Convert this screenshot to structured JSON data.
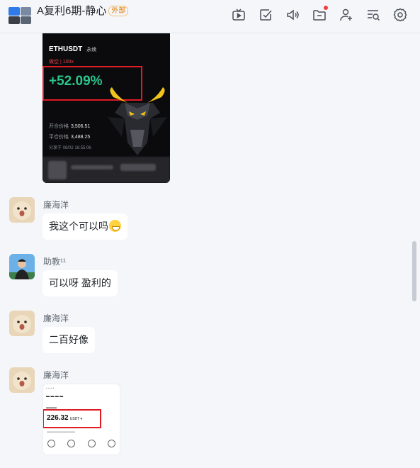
{
  "header": {
    "title": "A复利6期-静心",
    "tag": "外部",
    "subtitle": "",
    "tools": [
      "live-icon",
      "task-icon",
      "announcement-icon",
      "folder-icon",
      "add-member-icon",
      "search-history-icon",
      "settings-icon"
    ]
  },
  "share_card": {
    "symbol": "ETHUSDT",
    "perp": "永续",
    "direction": "做空 | 100x",
    "pnl": "+52.09%",
    "open_label": "开仓价格",
    "open_price": "3,506.51",
    "close_label": "平仓价格",
    "close_price": "3,488.25",
    "shared_at": "分享于 08/02 16:55:06"
  },
  "messages": [
    {
      "sender": "廉海洋",
      "text": "我这个可以吗",
      "emoji": "grinning-sweat-emoji"
    },
    {
      "sender": "助教¹¹",
      "text": "可以呀 盈利的"
    },
    {
      "sender": "廉海洋",
      "text": "二百好像"
    },
    {
      "sender": "廉海洋",
      "text": ""
    }
  ],
  "screenshot": {
    "balance": "226.32",
    "unit": "USDT ▾"
  },
  "colors": {
    "accent_green": "#2bc58b",
    "highlight_red": "#e01b24",
    "tag_orange": "#e07b00"
  }
}
